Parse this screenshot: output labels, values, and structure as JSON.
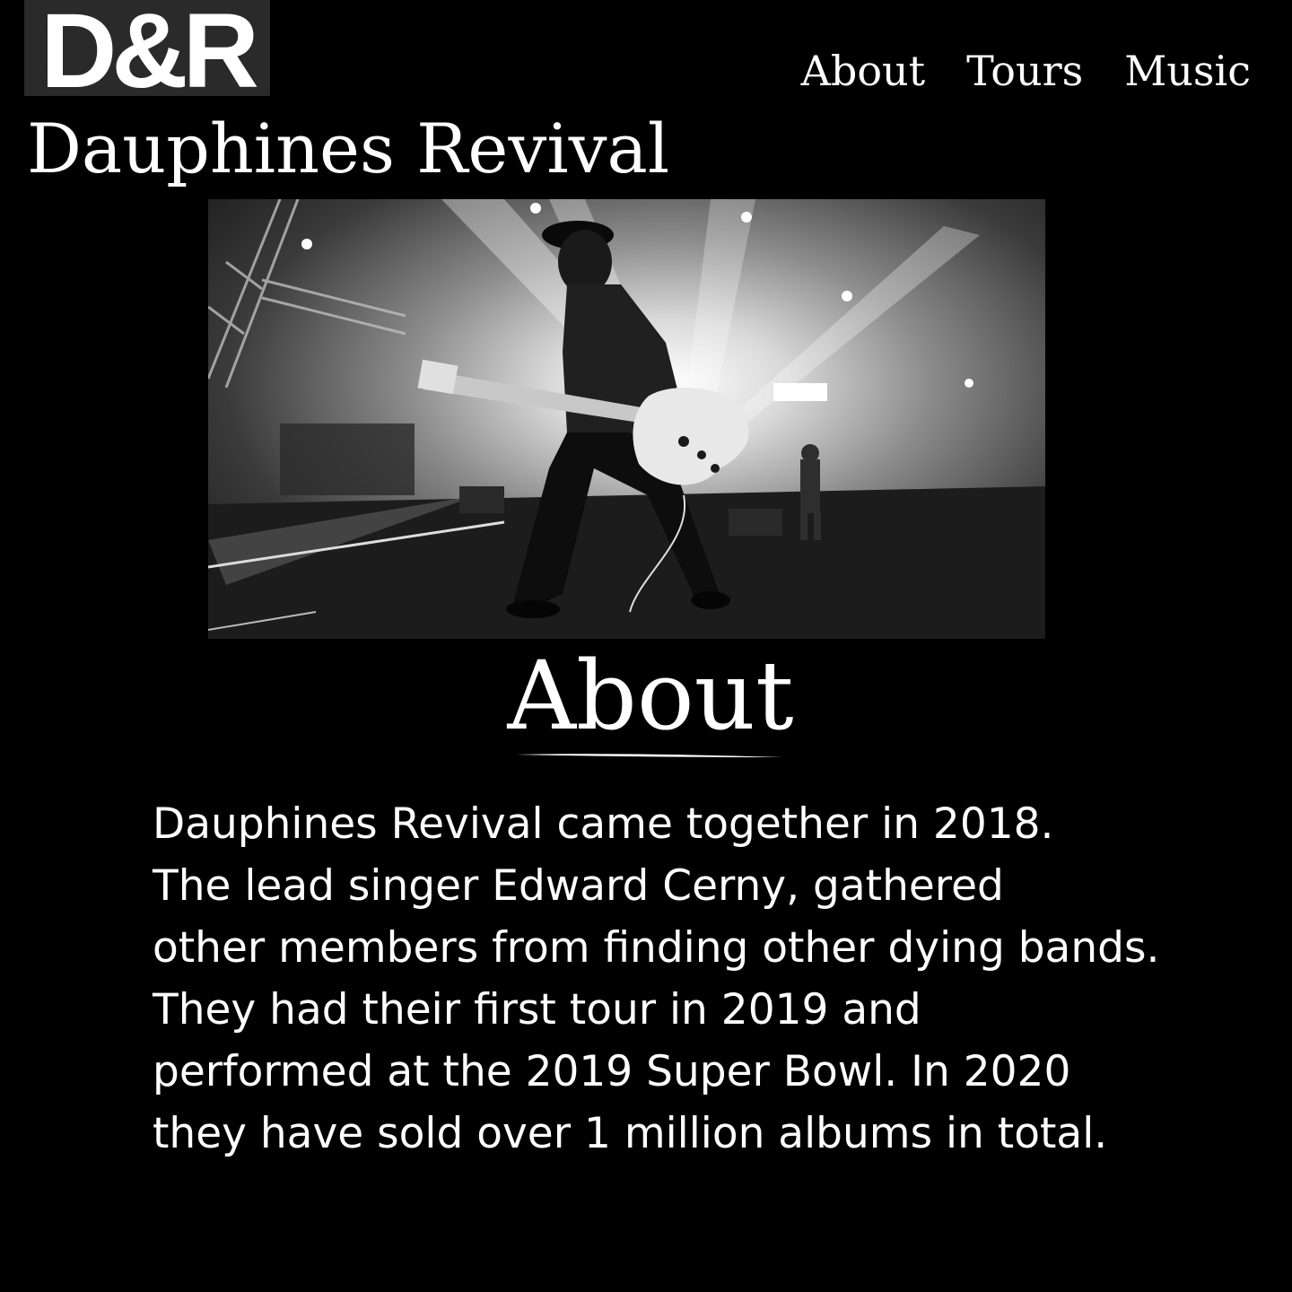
{
  "logo": {
    "text": "D&R"
  },
  "nav": {
    "items": [
      {
        "label": "About"
      },
      {
        "label": "Tours"
      },
      {
        "label": "Music"
      }
    ]
  },
  "site_title": "Dauphines Revival",
  "hero": {
    "icon": "concert-guitarist-photo"
  },
  "about": {
    "heading": "About",
    "lines": [
      "Dauphines Revival came together in 2018.",
      "The lead singer Edward Cerny, gathered",
      "other members from finding other dying bands.",
      "They had their first tour in 2019 and",
      "performed at the 2019 Super Bowl. In 2020",
      "they have sold over 1 million albums in total."
    ]
  },
  "colors": {
    "background": "#000000",
    "text": "#ffffff",
    "logo_background": "#2a2a2a"
  }
}
